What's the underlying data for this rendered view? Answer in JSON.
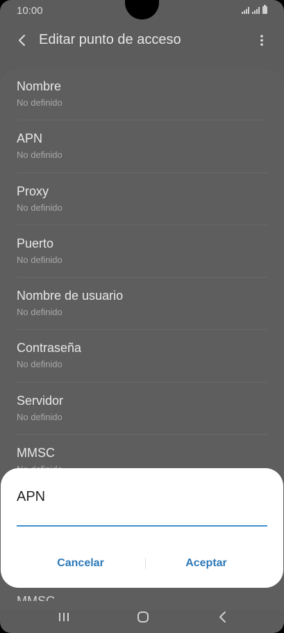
{
  "status_bar": {
    "time": "10:00",
    "icons": [
      "signal-icon",
      "signal-icon",
      "battery-icon"
    ]
  },
  "header": {
    "back_icon": "chevron-left-icon",
    "title": "Editar punto de acceso",
    "menu_icon": "more-vertical-icon"
  },
  "fields": [
    {
      "label": "Nombre",
      "value": "No definido"
    },
    {
      "label": "APN",
      "value": "No definido"
    },
    {
      "label": "Proxy",
      "value": "No definido"
    },
    {
      "label": "Puerto",
      "value": "No definido"
    },
    {
      "label": "Nombre de usuario",
      "value": "No definido"
    },
    {
      "label": "Contraseña",
      "value": "No definido"
    },
    {
      "label": "Servidor",
      "value": "No definido"
    },
    {
      "label": "MMSC",
      "value": "No definido"
    }
  ],
  "dialog": {
    "title": "APN",
    "input_value": "",
    "cancel_label": "Cancelar",
    "accept_label": "Aceptar"
  },
  "colors": {
    "accent": "#3e8ccc",
    "button_text": "#2c79b8",
    "overlay_bg": "#5c5c5c",
    "dialog_bg": "#ffffff"
  },
  "nav_bar": {
    "icons": [
      "recents-icon",
      "home-icon",
      "back-icon"
    ]
  }
}
